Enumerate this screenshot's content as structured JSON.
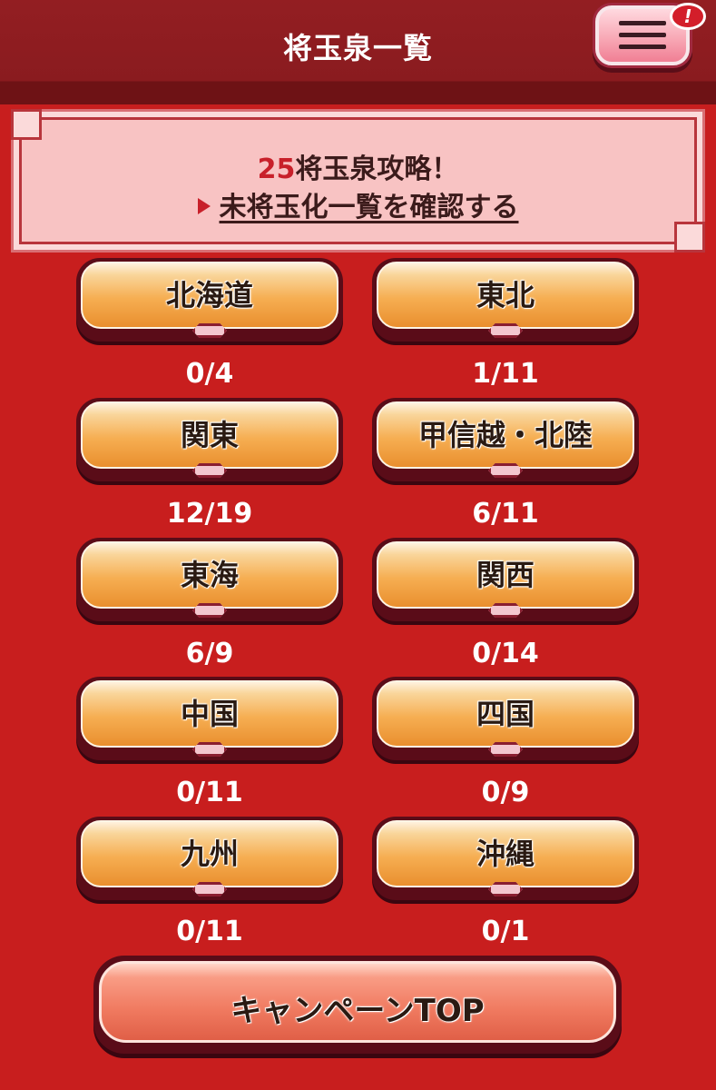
{
  "header": {
    "title": "将玉泉一覧",
    "menu_badge": "!"
  },
  "banner": {
    "count": "25",
    "line1_suffix": "将玉泉攻略！",
    "link_text": "未将玉化一覧を確認する"
  },
  "regions": [
    {
      "label": "北海道",
      "progress": "0/4"
    },
    {
      "label": "東北",
      "progress": "1/11"
    },
    {
      "label": "関東",
      "progress": "12/19"
    },
    {
      "label": "甲信越・北陸",
      "progress": "6/11"
    },
    {
      "label": "東海",
      "progress": "6/9"
    },
    {
      "label": "関西",
      "progress": "0/14"
    },
    {
      "label": "中国",
      "progress": "0/11"
    },
    {
      "label": "四国",
      "progress": "0/9"
    },
    {
      "label": "九州",
      "progress": "0/11"
    },
    {
      "label": "沖縄",
      "progress": "0/1"
    }
  ],
  "campaign_top_label": "キャンペーンTOP",
  "colors": {
    "background": "#c81e1e",
    "header": "#931e22",
    "button_orange": "#f6ae52",
    "accent_red": "#c8202a"
  }
}
